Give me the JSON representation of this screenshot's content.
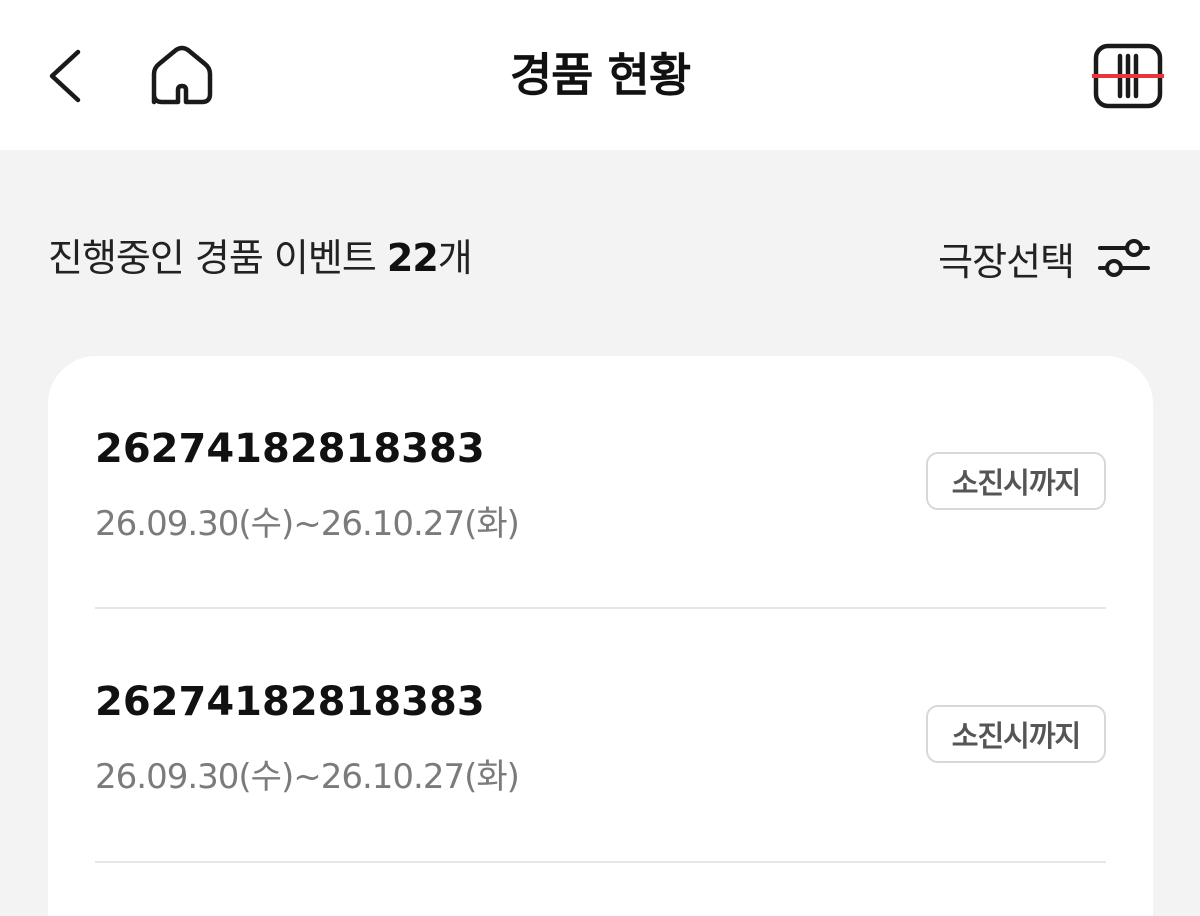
{
  "header": {
    "title": "경품 현황",
    "back_icon": "chevron-left-icon",
    "home_icon": "home-icon",
    "ticket_icon": "ticket-icon",
    "accent_color": "#e8343a"
  },
  "summary": {
    "prefix": "진행중인 경품 이벤트 ",
    "count": "22",
    "suffix": "개",
    "theater_select_label": "극장선택",
    "filter_icon": "sliders-icon"
  },
  "events": [
    {
      "id": "26274182818383",
      "period": "26.09.30(수)~26.10.27(화)",
      "badge": "소진시까지"
    },
    {
      "id": "26274182818383",
      "period": "26.09.30(수)~26.10.27(화)",
      "badge": "소진시까지"
    }
  ]
}
